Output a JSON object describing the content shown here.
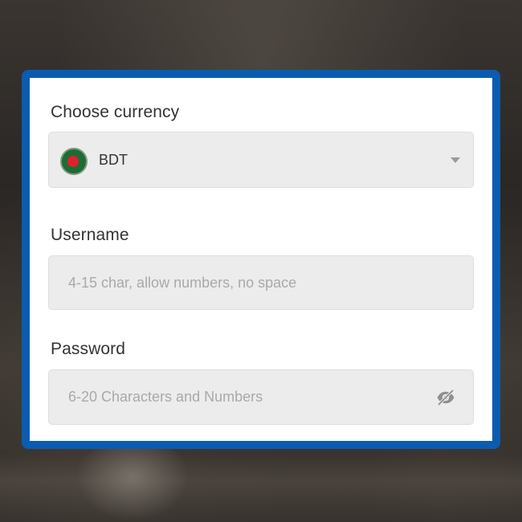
{
  "currency": {
    "label": "Choose currency",
    "selected": "BDT",
    "flag_icon": "bangladesh-flag-icon"
  },
  "username": {
    "label": "Username",
    "placeholder": "4-15 char, allow numbers, no space",
    "value": ""
  },
  "password": {
    "label": "Password",
    "placeholder": "6-20 Characters and Numbers",
    "value": "",
    "toggle_icon": "eye-slash-icon"
  },
  "colors": {
    "frame": "#0b5cb0",
    "field_bg": "#ececec",
    "label_text": "#333333",
    "placeholder_text": "#a9a9a9"
  }
}
